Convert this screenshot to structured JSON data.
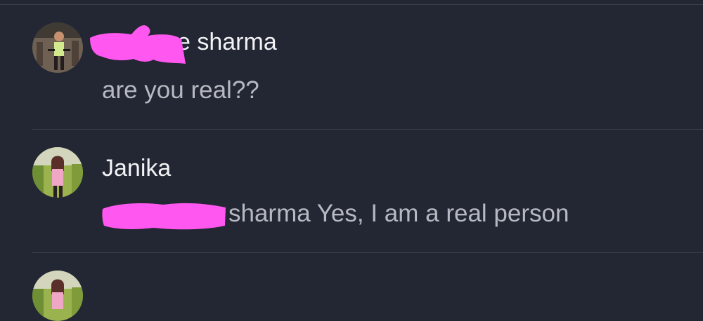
{
  "comments": [
    {
      "author": "e sharma",
      "text": "are you real??"
    },
    {
      "author": "Janika",
      "text": "sharma Yes, I am a real person"
    },
    {
      "author": "",
      "text": ""
    }
  ],
  "colors": {
    "background": "#232734",
    "divider": "#3a3f4c",
    "author_text": "#f2f3f5",
    "body_text": "#b6b9c1",
    "redaction": "#ff57f0"
  }
}
